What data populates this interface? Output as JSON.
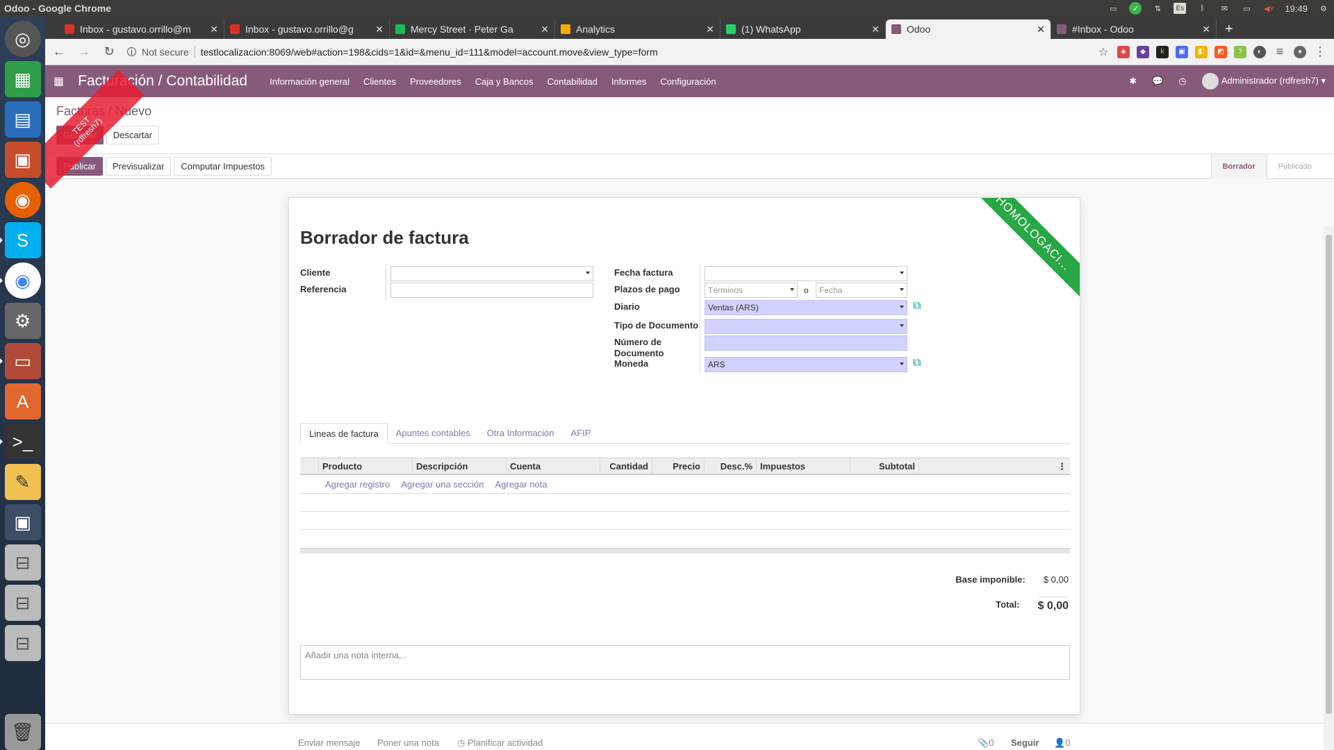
{
  "system": {
    "window_title": "Odoo - Google Chrome",
    "lang": "Es",
    "time": "19:49"
  },
  "tabs": [
    {
      "title": "Inbox - gustavo.orrillo@m",
      "icon": "gmail-icon",
      "color": "#d93025"
    },
    {
      "title": "Inbox - gustavo.orrillo@g",
      "icon": "gmail-icon",
      "color": "#d93025"
    },
    {
      "title": "Mercy Street · Peter Ga",
      "icon": "spotify-icon",
      "color": "#1db954"
    },
    {
      "title": "Analytics",
      "icon": "analytics-icon",
      "color": "#f9ab00"
    },
    {
      "title": "(1) WhatsApp",
      "icon": "whatsapp-icon",
      "color": "#25d366"
    },
    {
      "title": "Odoo",
      "icon": "odoo-icon",
      "color": "#875a7b"
    },
    {
      "title": "#Inbox - Odoo",
      "icon": "odoo-icon",
      "color": "#875a7b"
    }
  ],
  "address": {
    "security": "Not secure",
    "url": "testlocalizacion:8069/web#action=198&cids=1&id=&menu_id=111&model=account.move&view_type=form"
  },
  "navbar": {
    "app_name": "Facturación / Contabilidad",
    "menus": [
      "Información general",
      "Clientes",
      "Proveedores",
      "Caja y Bancos",
      "Contabilidad",
      "Informes",
      "Configuración"
    ],
    "user": "Administrador (rdfresh7)",
    "color": "#875a7b"
  },
  "ribbon": {
    "line1": "TEST",
    "line2": "(rdfresh7)"
  },
  "breadcrumb": {
    "parent": "Facturas",
    "sep": "/",
    "current": "Nuevo"
  },
  "control": {
    "save": "Guardar",
    "discard": "Descartar"
  },
  "statusbar": {
    "publish": "Publicar",
    "preview": "Previsualizar",
    "compute_taxes": "Computar Impuestos",
    "states": [
      "Borrador",
      "Publicado"
    ],
    "current_state": "Borrador"
  },
  "sheet": {
    "ribbon": "HOMOLOGACI...",
    "title": "Borrador de factura",
    "left_fields": {
      "cliente_label": "Cliente",
      "cliente_value": "",
      "referencia_label": "Referencia",
      "referencia_value": ""
    },
    "right_fields": {
      "fecha_label": "Fecha factura",
      "fecha_value": "",
      "plazos_label": "Plazos de pago",
      "terminos_placeholder": "Términos",
      "or": "o",
      "fecha_placeholder": "Fecha",
      "diario_label": "Diario",
      "diario_value": "Ventas (ARS)",
      "tipo_doc_label": "Tipo de Documento",
      "tipo_doc_value": "",
      "numero_doc_label": "Número de Documento",
      "numero_doc_value": "",
      "moneda_label": "Moneda",
      "moneda_value": "ARS"
    },
    "notebook_tabs": [
      "Lineas de factura",
      "Apuntes contables",
      "Otra Información",
      "AFIP"
    ],
    "active_tab": "Lineas de factura",
    "columns": [
      "Producto",
      "Descripción",
      "Cuenta",
      "Cantidad",
      "Precio",
      "Desc.%",
      "Impuestos",
      "Subtotal"
    ],
    "add_links": [
      "Agregar registro",
      "Agregar una sección",
      "Agregar nota"
    ],
    "totals": {
      "base_label": "Base imponible:",
      "base_value": "$ 0,00",
      "total_label": "Total:",
      "total_value": "$ 0,00"
    },
    "note_placeholder": "Añadir una nota interna..."
  },
  "chatter": {
    "send_message": "Enviar mensaje",
    "log_note": "Poner una nota",
    "schedule": "Planificar actividad",
    "attachments": "0",
    "follow": "Seguir",
    "followers": "0"
  }
}
